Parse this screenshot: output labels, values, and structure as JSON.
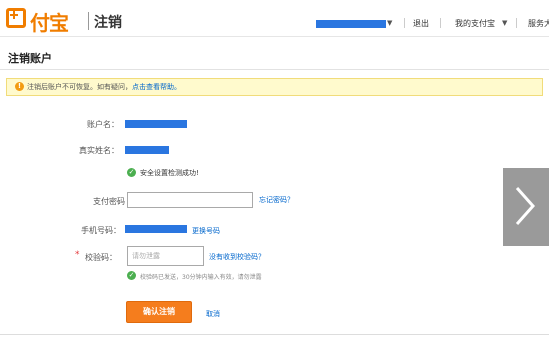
{
  "header": {
    "logo_text": "付宝",
    "page_title": "注销",
    "nav_logout": "退出",
    "nav_my": "我的支付宝",
    "nav_more": "服务大"
  },
  "page": {
    "heading": "注销账户"
  },
  "notice": {
    "text": "注销后账户不可恢复。如有疑问，",
    "link": "点击查看帮助。"
  },
  "form": {
    "account_label": "账户名：",
    "realname_label": "真实姓名：",
    "security_ok": "安全设置检测成功!",
    "password_label": "支付密码",
    "forgot_password": "忘记密码？",
    "phone_label": "手机号码：",
    "change_phone": "更换号码",
    "code_label": "校验码：",
    "code_placeholder": "请勿泄露",
    "no_code": "没有收到校验码？",
    "code_sent_hint": "校验码已发送，30分钟内输入有效，请勿泄露",
    "confirm_button": "确认注销",
    "cancel": "取消"
  },
  "colors": {
    "accent": "#f57d1d",
    "link": "#0066cc",
    "masked_bar": "#2a76e0"
  }
}
